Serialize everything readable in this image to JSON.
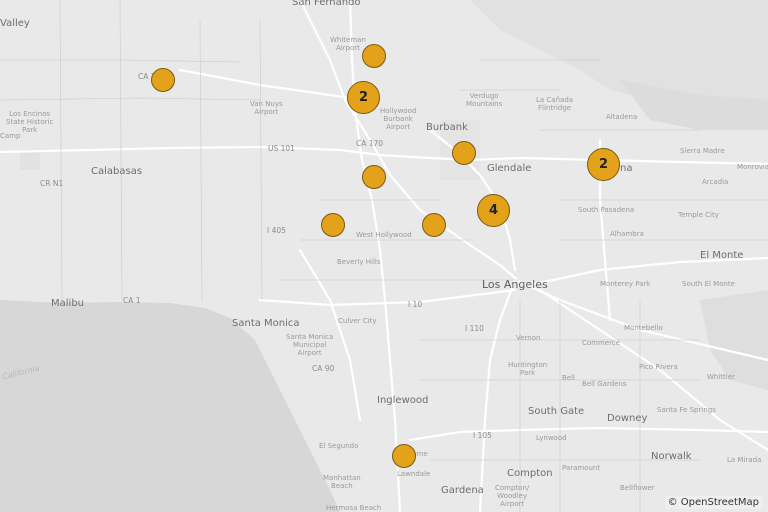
{
  "attribution": "© OpenStreetMap",
  "colors": {
    "marker_fill": "#e3a21a",
    "marker_border": "#7a5a10",
    "land": "#e9e9e9",
    "water": "#d6d6d6"
  },
  "labels": {
    "san_fernando": "San Fernando",
    "whiteman": "Whiteman\nAirport",
    "valley": "Valley",
    "ca2": "CA 2",
    "van_nuys": "Van Nuys\nAirport",
    "los_encinos": "Los Encinos\nState Historic\nPark",
    "camp": "Camp",
    "verdugo": "Verdugo\nMountains",
    "la_canada": "La Cañada\nFlintridge",
    "altadena": "Altadena",
    "hollywood_burbank": "Hollywood\nBurbank\nAirport",
    "burbank": "Burbank",
    "us101": "US 101",
    "ca170": "CA 170",
    "sierra_madre": "Sierra Madre",
    "calabasas": "Calabasas",
    "glendale": "Glendale",
    "pasadena_tail": "na",
    "monrovia": "Monrovia",
    "crn1": "CR N1",
    "arcadia": "Arcadia",
    "south_pasadena": "South Pasadena",
    "temple_city": "Temple City",
    "i405": "I 405",
    "west_hollywood": "West Hollywood",
    "alhambra": "Alhambra",
    "el_monte": "El Monte",
    "beverly_hills": "Beverly Hills",
    "los_angeles": "Los Angeles",
    "monterey_park": "Monterey Park",
    "south_el_monte": "South El Monte",
    "malibu": "Malibu",
    "ca1": "CA 1",
    "i10": "I 10",
    "santa_monica": "Santa Monica",
    "culver_city": "Culver City",
    "smo_airport": "Santa Monica\nMunicipal\nAirport",
    "i110": "I 110",
    "montebello": "Montebello",
    "vernon": "Vernon",
    "commerce": "Commerce",
    "ca90": "CA 90",
    "huntington_park": "Huntington\nPark",
    "bell": "Bell",
    "pico_rivera": "Pico Rivera",
    "bell_gardens": "Bell Gardens",
    "whittier": "Whittier",
    "california": "California",
    "inglewood": "Inglewood",
    "south_gate": "South Gate",
    "downey": "Downey",
    "santa_fe_springs": "Santa Fe Springs",
    "i105": "I 105",
    "lynwood": "Lynwood",
    "el_segundo": "El Segundo",
    "hawthorne_tail": "orne",
    "paramount": "Paramount",
    "norwalk": "Norwalk",
    "lawndale": "Lawndale",
    "manhattan_beach": "Manhattan\nBeach",
    "compton": "Compton",
    "compton_airport": "Compton/\nWoodley\nAirport",
    "la_mirada": "La Mirada",
    "gardena": "Gardena",
    "bellflower": "Bellflower",
    "hermosa_beach": "Hermosa Beach"
  },
  "markers": [
    {
      "name": "marker-1",
      "count": ""
    },
    {
      "name": "marker-2",
      "count": ""
    },
    {
      "name": "cluster-burbank",
      "count": "2"
    },
    {
      "name": "marker-3",
      "count": ""
    },
    {
      "name": "cluster-pasadena",
      "count": "2"
    },
    {
      "name": "marker-4",
      "count": ""
    },
    {
      "name": "cluster-downtown",
      "count": "4"
    },
    {
      "name": "marker-5",
      "count": ""
    },
    {
      "name": "marker-6",
      "count": ""
    },
    {
      "name": "marker-7",
      "count": ""
    }
  ]
}
